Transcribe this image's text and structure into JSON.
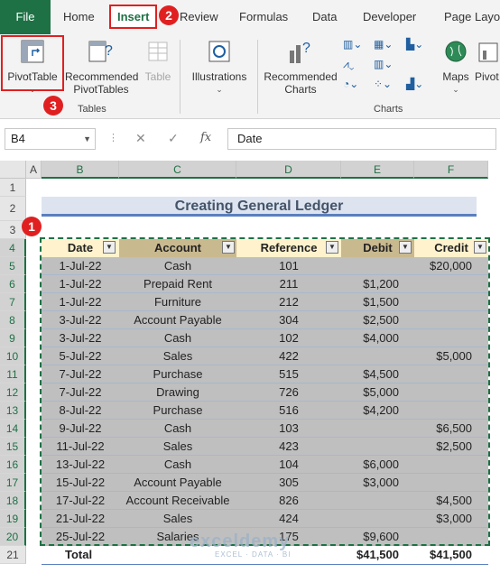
{
  "tabs": [
    "File",
    "Home",
    "Insert",
    "Review",
    "Formulas",
    "Data",
    "Developer",
    "Page Layo"
  ],
  "active_tab": "Insert",
  "callouts": [
    "1",
    "2",
    "3"
  ],
  "ribbon": {
    "pivot_table": "PivotTable",
    "recommended_pivot_tables": [
      "Recommended",
      "PivotTables"
    ],
    "table": "Table",
    "illustrations": "Illustrations",
    "recommended_charts": [
      "Recommended",
      "Charts"
    ],
    "maps": "Maps",
    "pivot_chart": "Pivot",
    "group_tables": "Tables",
    "group_charts": "Charts"
  },
  "formula_bar": {
    "name_box": "B4",
    "formula": "Date",
    "fx": "fx"
  },
  "columns": [
    "A",
    "B",
    "C",
    "D",
    "E",
    "F"
  ],
  "rows": [
    "1",
    "2",
    "3",
    "4",
    "5",
    "6",
    "7",
    "8",
    "9",
    "10",
    "11",
    "12",
    "13",
    "14",
    "15",
    "16",
    "17",
    "18",
    "19",
    "20",
    "21"
  ],
  "sheet_title": "Creating General Ledger",
  "table": {
    "headers": [
      "Date",
      "Account",
      "Reference",
      "Debit",
      "Credit"
    ],
    "rows": [
      [
        "1-Jul-22",
        "Cash",
        "101",
        "",
        "$20,000"
      ],
      [
        "1-Jul-22",
        "Prepaid Rent",
        "211",
        "$1,200",
        ""
      ],
      [
        "1-Jul-22",
        "Furniture",
        "212",
        "$1,500",
        ""
      ],
      [
        "3-Jul-22",
        "Account Payable",
        "304",
        "$2,500",
        ""
      ],
      [
        "3-Jul-22",
        "Cash",
        "102",
        "$4,000",
        ""
      ],
      [
        "5-Jul-22",
        "Sales",
        "422",
        "",
        "$5,000"
      ],
      [
        "7-Jul-22",
        "Purchase",
        "515",
        "$4,500",
        ""
      ],
      [
        "7-Jul-22",
        "Drawing",
        "726",
        "$5,000",
        ""
      ],
      [
        "8-Jul-22",
        "Purchase",
        "516",
        "$4,200",
        ""
      ],
      [
        "9-Jul-22",
        "Cash",
        "103",
        "",
        "$6,500"
      ],
      [
        "11-Jul-22",
        "Sales",
        "423",
        "",
        "$2,500"
      ],
      [
        "13-Jul-22",
        "Cash",
        "104",
        "$6,000",
        ""
      ],
      [
        "15-Jul-22",
        "Account Payable",
        "305",
        "$3,000",
        ""
      ],
      [
        "17-Jul-22",
        "Account Receivable",
        "826",
        "",
        "$4,500"
      ],
      [
        "21-Jul-22",
        "Sales",
        "424",
        "",
        "$3,000"
      ],
      [
        "25-Jul-22",
        "Salaries",
        "175",
        "$9,600",
        ""
      ]
    ],
    "total_label": "Total",
    "total_debit": "$41,500",
    "total_credit": "$41,500"
  },
  "watermark": {
    "name": "exceldemy",
    "tagline": "EXCEL · DATA · BI"
  },
  "colors": {
    "excel_green": "#1e7145",
    "callout_red": "#e02020",
    "header_light": "#fff2cc",
    "header_dark": "#c9b98f",
    "row_fill": "#bfbfbf"
  }
}
